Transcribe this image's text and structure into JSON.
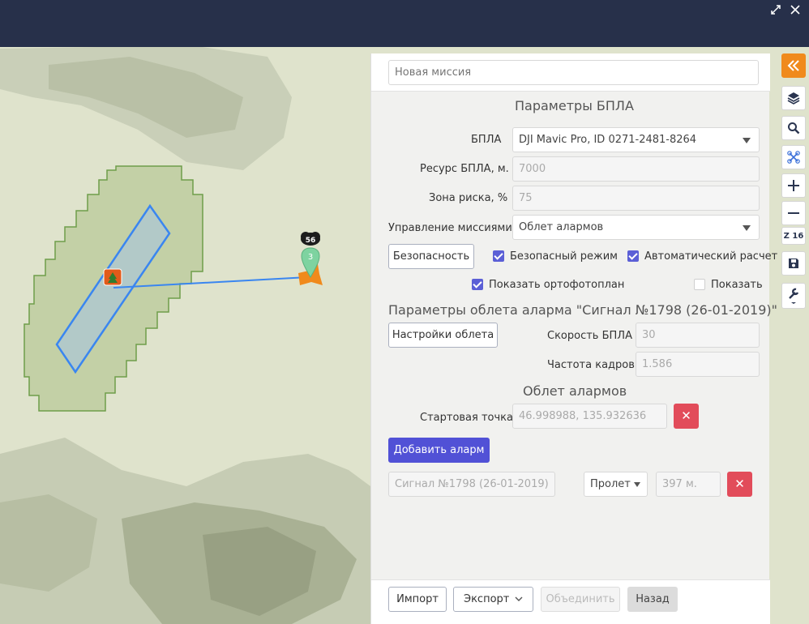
{
  "window": {
    "resize_icon": "expand-icon",
    "close_icon": "close-icon"
  },
  "mission": {
    "name_placeholder": "Новая миссия"
  },
  "uav_params": {
    "title": "Параметры БПЛА",
    "uav_label": "БПЛА",
    "uav_value": "DJI Mavic Pro, ID 0271-2481-8264",
    "resource_label": "Ресурс БПЛА, м.",
    "resource_value": "7000",
    "risk_label": "Зона риска, %",
    "risk_value": "75",
    "mission_control_label": "Управление миссиями",
    "mission_control_value": "Облет алармов",
    "safety_button": "Безопасность",
    "safe_mode_label": "Безопасный режим",
    "safe_mode_checked": true,
    "auto_calc_label": "Автоматический расчет",
    "auto_calc_checked": true,
    "ortho_label": "Показать ортофотоплан",
    "ortho_checked": true,
    "show_label": "Показать",
    "show_checked": false
  },
  "flyover": {
    "title": "Параметры облета аларма  \"Сигнал №1798 (26-01-2019)\"",
    "settings_button": "Настройки облета",
    "speed_label": "Скорость БПЛА",
    "speed_value": "30",
    "frame_rate_label": "Частота кадров",
    "frame_rate_value": "1.586"
  },
  "alarms": {
    "title": "Облет алармов",
    "start_label": "Стартовая точка",
    "start_value": "46.998988, 135.932636",
    "delete_symbol": "✕",
    "add_button": "Добавить аларм",
    "items": [
      {
        "name": "Сигнал №1798 (26-01-2019)",
        "mode": "Пролет",
        "distance": "397 м."
      }
    ]
  },
  "footer": {
    "import": "Импорт",
    "export": "Экспорт",
    "merge": "Объединить",
    "back": "Назад"
  },
  "map": {
    "marker_count": "56",
    "marker_number": "3"
  },
  "toolbar": {
    "zoom_label": "Z 16",
    "icons": [
      "collapse-panel-icon",
      "layers-icon",
      "search-icon",
      "drone-icon",
      "zoom-in-icon",
      "zoom-out-icon",
      "save-icon",
      "wrench-icon"
    ]
  },
  "colors": {
    "topbar": "#27304a",
    "accent": "#f08a1c",
    "primary": "#5151d6",
    "danger": "#e24c5a",
    "zone_fill": "#b9c99a",
    "zone_stroke": "#6f9e4a",
    "route": "#3a86f0"
  }
}
